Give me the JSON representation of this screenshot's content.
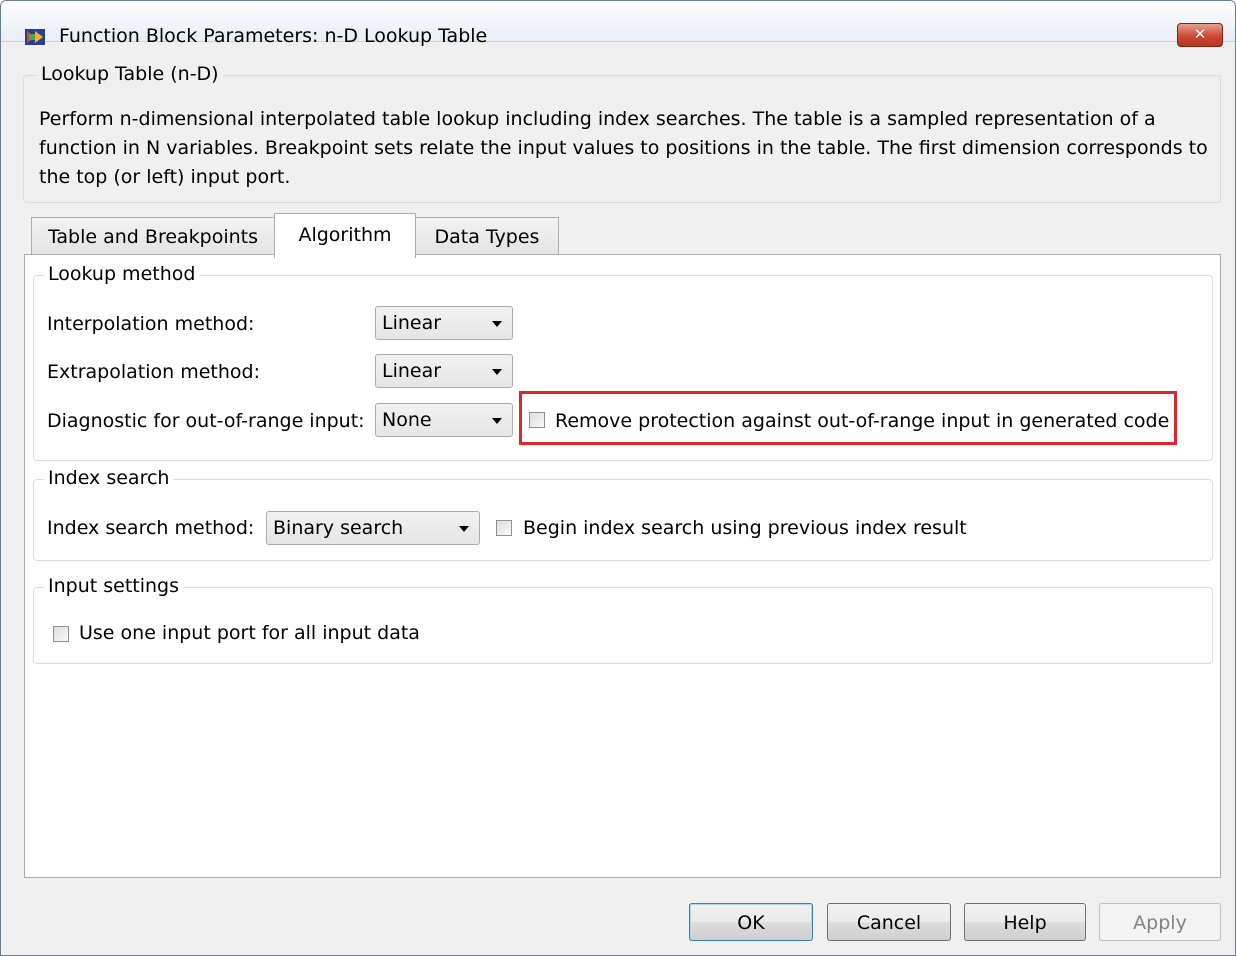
{
  "window": {
    "title": "Function Block Parameters: n-D Lookup Table",
    "close_label": "✕"
  },
  "block": {
    "group_label": "Lookup Table (n-D)",
    "description": "Perform n-dimensional interpolated table lookup including index searches. The table is a sampled representation of a function in N variables. Breakpoint sets relate the input values to positions in the table. The first dimension corresponds to the top (or left) input port."
  },
  "tabs": [
    {
      "label": "Table and Breakpoints",
      "active": false
    },
    {
      "label": "Algorithm",
      "active": true
    },
    {
      "label": "Data Types",
      "active": false
    }
  ],
  "lookup_method": {
    "group_label": "Lookup method",
    "interpolation_label": "Interpolation method:",
    "interpolation_value": "Linear",
    "extrapolation_label": "Extrapolation method:",
    "extrapolation_value": "Linear",
    "diagnostic_label": "Diagnostic for out-of-range input:",
    "diagnostic_value": "None",
    "remove_protection_label": "Remove protection against out-of-range input in generated code",
    "remove_protection_checked": false
  },
  "index_search": {
    "group_label": "Index search",
    "method_label": "Index search method:",
    "method_value": "Binary search",
    "begin_label": "Begin index search using previous index result",
    "begin_checked": false
  },
  "input_settings": {
    "group_label": "Input settings",
    "one_port_label": "Use one input port for all input data",
    "one_port_checked": false
  },
  "buttons": {
    "ok": "OK",
    "cancel": "Cancel",
    "help": "Help",
    "apply": "Apply"
  },
  "colors": {
    "highlight": "#e0252d",
    "panel_bg": "#ffffff",
    "dialog_bg": "#f0f0f0"
  }
}
